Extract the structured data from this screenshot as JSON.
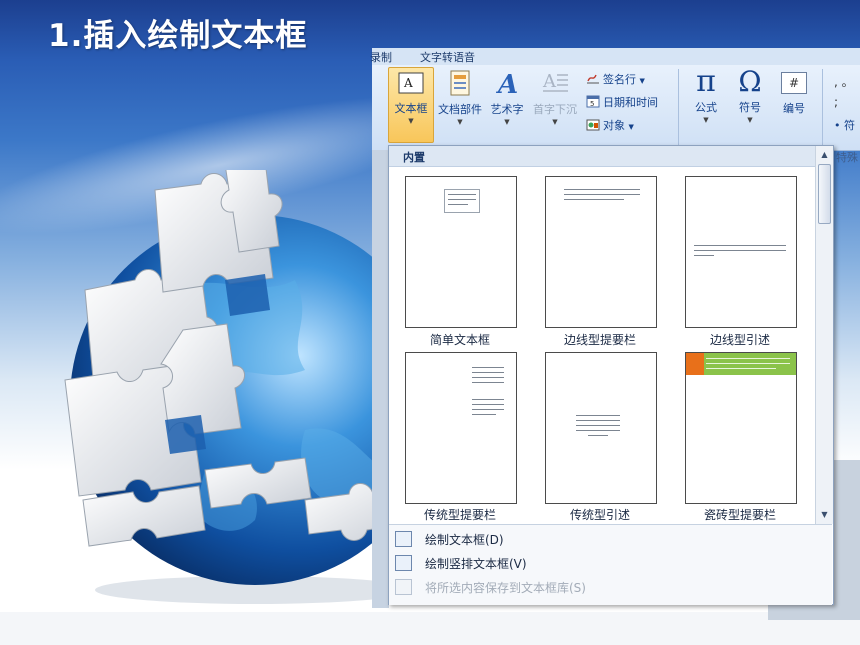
{
  "slide": {
    "title": "1.插入绘制文本框"
  },
  "ribbon": {
    "tabs": [
      "录制",
      "文字转语音"
    ],
    "buttons": [
      {
        "label": "文本框",
        "icon": "text-box-icon",
        "state": "active"
      },
      {
        "label": "文档部件",
        "icon": "document-parts-icon",
        "state": "normal"
      },
      {
        "label": "艺术字",
        "icon": "wordart-icon",
        "state": "normal"
      },
      {
        "label": "首字下沉",
        "icon": "drop-cap-icon",
        "state": "disabled"
      }
    ],
    "small_buttons": [
      {
        "label": "签名行",
        "icon": "signature-line-icon",
        "has_dropdown": true
      },
      {
        "label": "日期和时间",
        "icon": "date-time-icon",
        "has_dropdown": false
      },
      {
        "label": "对象",
        "icon": "object-icon",
        "has_dropdown": true
      }
    ],
    "symbol_buttons": [
      {
        "label": "公式",
        "icon": "pi-equation-icon",
        "glyph": "π"
      },
      {
        "label": "符号",
        "icon": "omega-symbol-icon",
        "glyph": "Ω"
      },
      {
        "label": "编号",
        "icon": "number-icon",
        "glyph": "#"
      }
    ],
    "group_label": "特殊",
    "partial_label": "符"
  },
  "gallery": {
    "header": "内置",
    "items": [
      {
        "label": "简单文本框",
        "accent": ""
      },
      {
        "label": "边线型提要栏",
        "accent": ""
      },
      {
        "label": "边线型引述",
        "accent": ""
      },
      {
        "label": "传统型提要栏",
        "accent": ""
      },
      {
        "label": "传统型引述",
        "accent": ""
      },
      {
        "label": "瓷砖型提要栏",
        "accent": "#e8701a"
      }
    ],
    "menu": [
      {
        "label": "绘制文本框(D)",
        "icon": "draw-text-box-icon",
        "enabled": true
      },
      {
        "label": "绘制竖排文本框(V)",
        "icon": "draw-vertical-text-box-icon",
        "enabled": true
      },
      {
        "label": "将所选内容保存到文本框库(S)",
        "icon": "save-to-gallery-icon",
        "enabled": false
      }
    ]
  },
  "colors": {
    "title_text": "#ffffff",
    "ribbon_active": "#f8c65a",
    "tile_orange": "#e8701a",
    "tile_green": "#8bc34a",
    "ribbon_text": "#15428b"
  }
}
